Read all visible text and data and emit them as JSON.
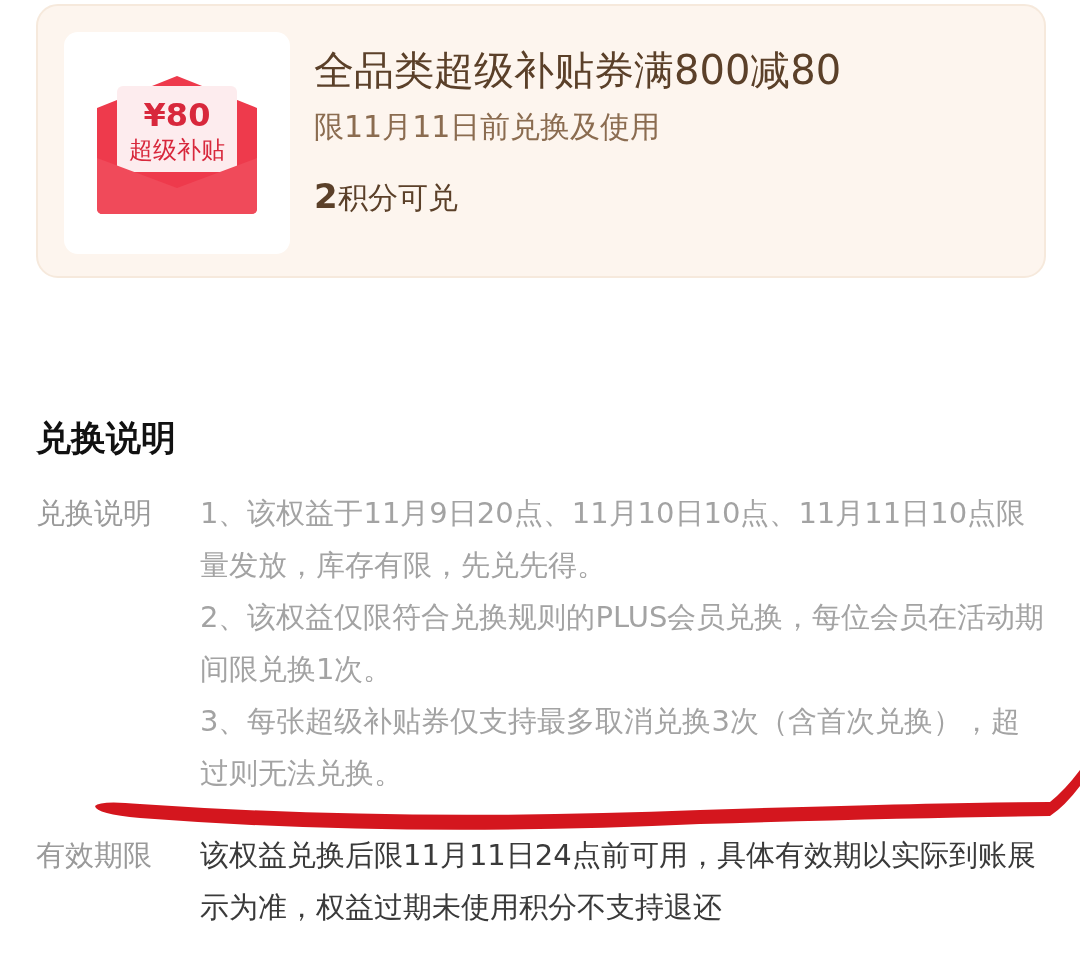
{
  "coupon": {
    "image": {
      "amount": "¥80",
      "label": "超级补贴"
    },
    "title": "全品类超级补贴券满800减80",
    "deadline": "限11月11日前兑换及使用",
    "points": "**2**积分可兑"
  },
  "section": {
    "heading": "兑换说明",
    "rows": [
      {
        "label": "兑换说明",
        "kind": "muted",
        "paragraphs": [
          "1、该权益于11月9日20点、11月10日10点、11月11日10点限量发放，库存有限，先兑先得。",
          "2、该权益仅限符合兑换规则的PLUS会员兑换，每位会员在活动期间限兑换1次。",
          "3、每张超级补贴券仅支持最多取消兑换3次（含首次兑换），超过则无法兑换。"
        ]
      },
      {
        "label": "有效期限",
        "kind": "dark",
        "paragraphs": [
          "该权益兑换后限11月11日24点前可用，具体有效期以实际到账展示为准，权益过期未使用积分不支持退还"
        ]
      }
    ]
  }
}
